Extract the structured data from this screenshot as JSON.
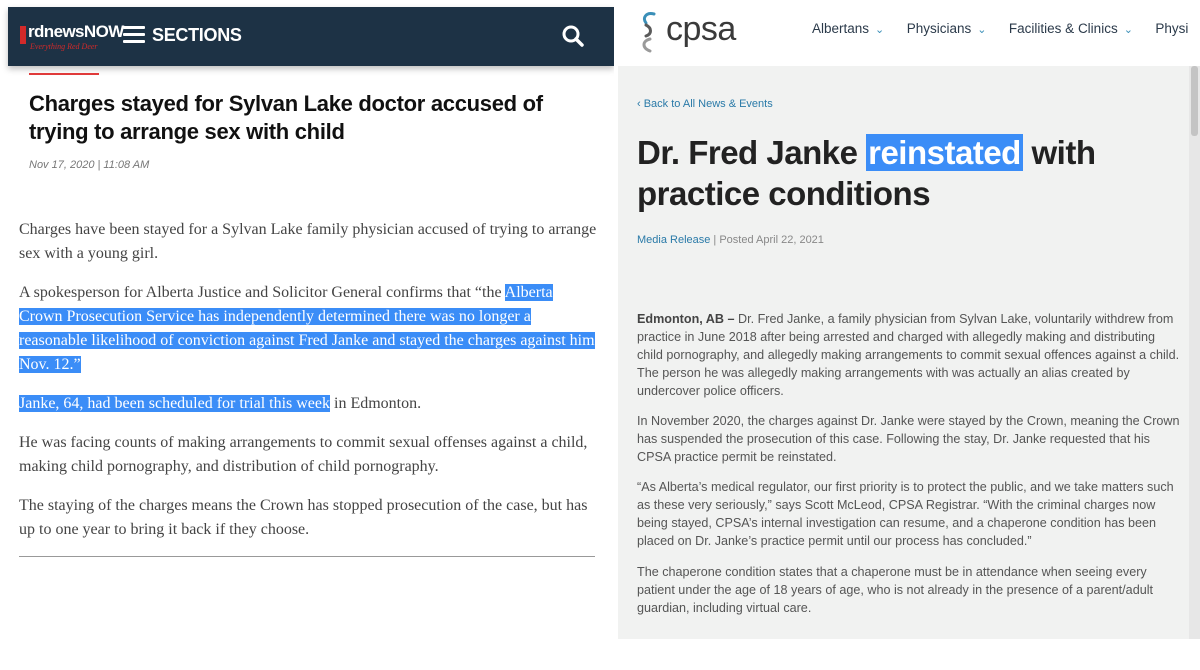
{
  "left": {
    "header": {
      "logo_name": "rdnewsNOW",
      "logo_tagline": "Everything Red Deer",
      "sections_label": "SECTIONS",
      "icons": [
        "menu-icon",
        "search-icon"
      ]
    },
    "article": {
      "title": "Charges stayed for Sylvan Lake doctor accused of trying to arrange sex with child",
      "date": "Nov 17, 2020 | 11:08 AM",
      "p1": "Charges have been stayed for a Sylvan Lake family physician accused of trying to arrange sex with a young girl.",
      "p2_pre": "A spokesperson for Alberta Justice and Solicitor General confirms that “the ",
      "p2_hl": "Alberta Crown Prosecution Service has independently determined there was no longer a reasonable likelihood of conviction against Fred Janke and stayed the charges against him Nov. 12.”",
      "p3_hl": "Janke, 64, had been scheduled for trial this week",
      "p3_post": " in Edmonton.",
      "p4": "He was facing counts of making arrangements to commit sexual offenses against a child, making child pornography, and distribution of child pornography.",
      "p5": "The staying of the charges means the Crown has stopped prosecution of the case, but has up to one year to bring it back if they choose."
    }
  },
  "right": {
    "logo_word": "cpsa",
    "nav": [
      "Albertans",
      "Physicians",
      "Facilities & Clinics",
      "Physi"
    ],
    "back_link": "‹ Back to All News & Events",
    "title_pre": "Dr. Fred Janke ",
    "title_hl": "reinstated",
    "title_post": " with practice conditions",
    "meta_category": "Media Release",
    "meta_posted": " | Posted April 22, 2021",
    "p1_lead": "Edmonton, AB –",
    "p1": " Dr. Fred Janke, a family physician from Sylvan Lake, voluntarily withdrew from practice in June 2018 after being arrested and charged with allegedly making and distributing child pornography, and allegedly making arrangements to commit sexual offences against a child. The person he was allegedly making arrangements with was actually an alias created by undercover police officers.",
    "p2": "In November 2020, the charges against Dr. Janke were stayed by the Crown, meaning the Crown has suspended the prosecution of this case. Following the stay, Dr. Janke requested that his CPSA practice permit be reinstated.",
    "p3": "“As Alberta’s medical regulator, our first priority is to protect the public, and we take matters such as these very seriously,” says Scott McLeod, CPSA Registrar. “With the criminal charges now being stayed, CPSA’s internal investigation can resume, and a chaperone condition has been placed on Dr. Janke’s practice permit until our process has concluded.”",
    "p4": "The chaperone condition states that a chaperone must be in attendance when seeing every patient under the age of 18 years of age, who is not already in the presence of a parent/adult guardian, including virtual care."
  },
  "colors": {
    "header_bg": "#1d3245",
    "highlight": "#3b8df7",
    "accent_red": "#d22a2a",
    "link_blue": "#2a7aa8"
  }
}
